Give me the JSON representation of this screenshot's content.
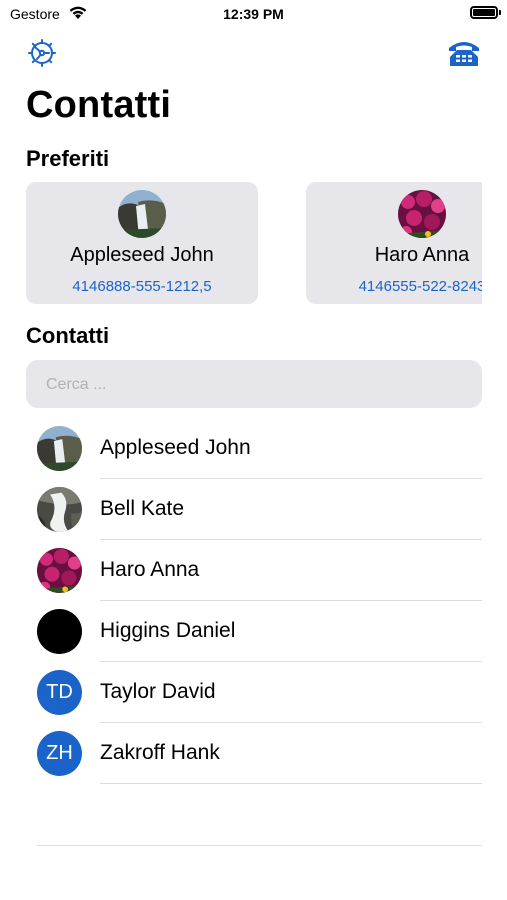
{
  "status_bar": {
    "carrier": "Gestore",
    "time": "12:39 PM",
    "battery_level": 1.0
  },
  "nav": {
    "settings_icon": "gear-icon",
    "phone_icon": "telephone-icon",
    "accent": "#1b65c8"
  },
  "title": "Contatti",
  "favorites": {
    "heading": "Preferiti",
    "items": [
      {
        "name": "Appleseed John",
        "phone": "4146888-555-1212,5",
        "photo": "waterfall-photo"
      },
      {
        "name": "Haro Anna",
        "phone": "4146555-522-8243",
        "photo": "flowers-photo"
      }
    ]
  },
  "contacts": {
    "heading": "Contatti",
    "search_placeholder": "Cerca ...",
    "items": [
      {
        "name": "Appleseed John",
        "avatar": "waterfall-photo"
      },
      {
        "name": "Bell Kate",
        "avatar": "river-photo"
      },
      {
        "name": "Haro Anna",
        "avatar": "flowers-photo"
      },
      {
        "name": "Higgins Daniel",
        "avatar": "black-photo"
      },
      {
        "name": "Taylor David",
        "initials": "TD"
      },
      {
        "name": "Zakroff Hank",
        "initials": "ZH"
      }
    ]
  }
}
